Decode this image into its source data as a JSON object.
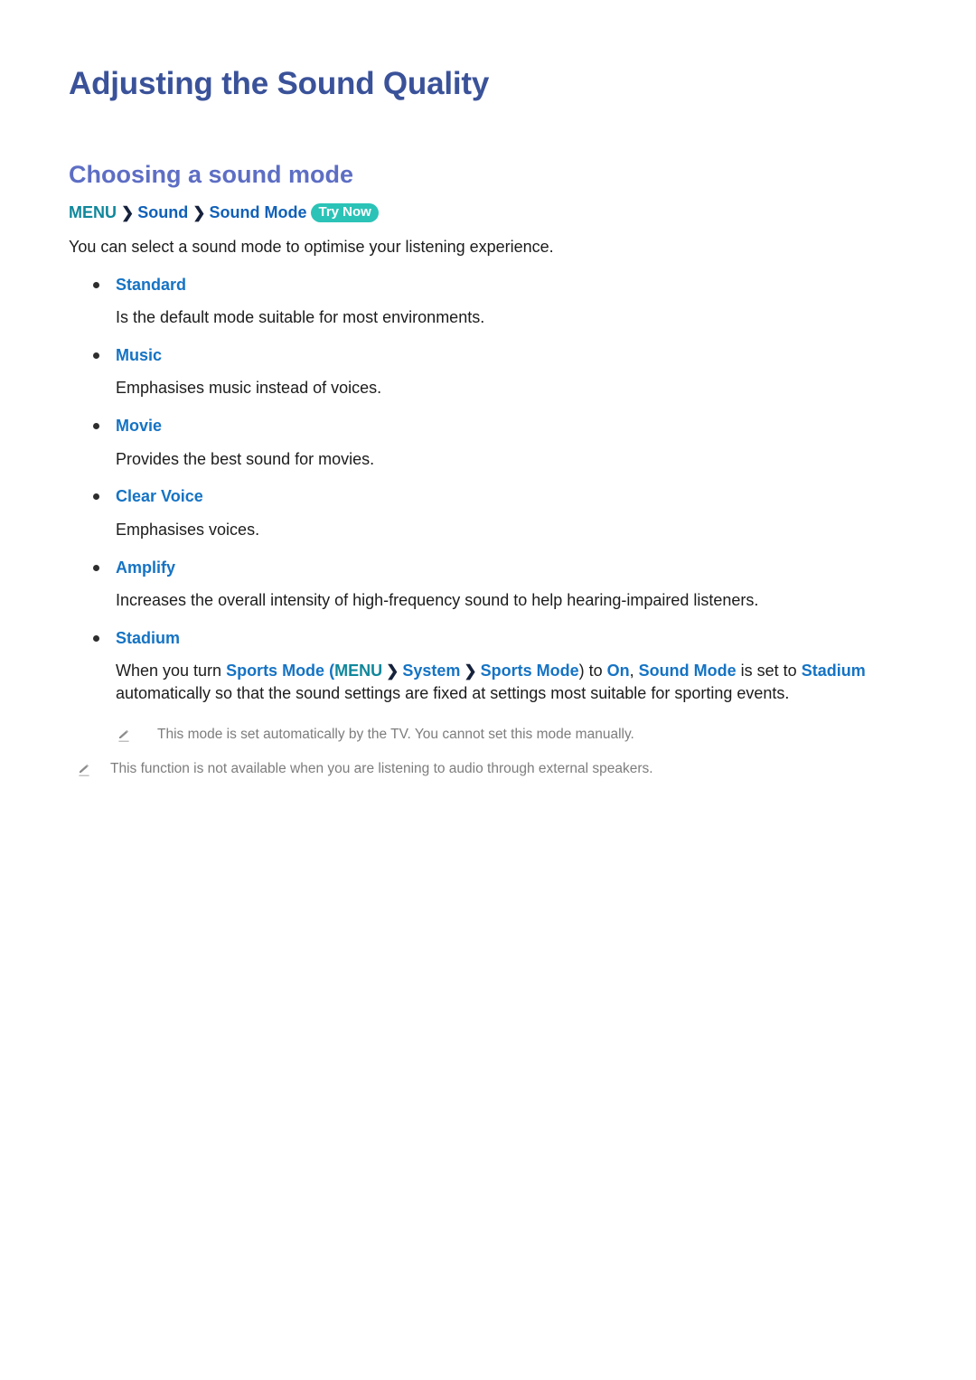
{
  "page": {
    "title": "Adjusting the Sound Quality",
    "section_heading": "Choosing a sound mode"
  },
  "menu_path": {
    "root": "MENU",
    "separator": "❯",
    "item1": "Sound",
    "item2": "Sound Mode",
    "badge": "Try Now"
  },
  "intro": "You can select a sound mode to optimise your listening experience.",
  "modes": [
    {
      "label": "Standard",
      "description": "Is the default mode suitable for most environments."
    },
    {
      "label": "Music",
      "description": "Emphasises music instead of voices."
    },
    {
      "label": "Movie",
      "description": "Provides the best sound for movies."
    },
    {
      "label": "Clear Voice",
      "description": "Emphasises voices."
    },
    {
      "label": "Amplify",
      "description": "Increases the overall intensity of high-frequency sound to help hearing-impaired listeners."
    },
    {
      "label": "Stadium",
      "description_parts": {
        "t1": "When you turn ",
        "b1": "Sports Mode",
        "t2": " (",
        "teal1": "MENU",
        "chev1": "❯",
        "b2": "System",
        "chev2": "❯",
        "b3": "Sports Mode",
        "t3": ") to ",
        "b4": "On",
        "t4": ", ",
        "b5": "Sound Mode",
        "t5": " is set to ",
        "b6": "Stadium",
        "t6": " automatically so that the sound settings are fixed at settings most suitable for sporting events."
      }
    }
  ],
  "notes": [
    {
      "icon": "pencil-icon",
      "text": "This mode is set automatically by the TV. You cannot set this mode manually."
    },
    {
      "icon": "pencil-icon",
      "text": "This function is not available when you are listening to audio through external speakers."
    }
  ],
  "colors": {
    "title": "#3a5299",
    "section_heading": "#5d6ec4",
    "link_blue": "#1573c4",
    "menu_teal": "#10879b",
    "badge_teal": "#2bc3b7",
    "body_text": "#1c1c1c",
    "note_gray": "#7d7d7d",
    "background": "#ffffff"
  }
}
